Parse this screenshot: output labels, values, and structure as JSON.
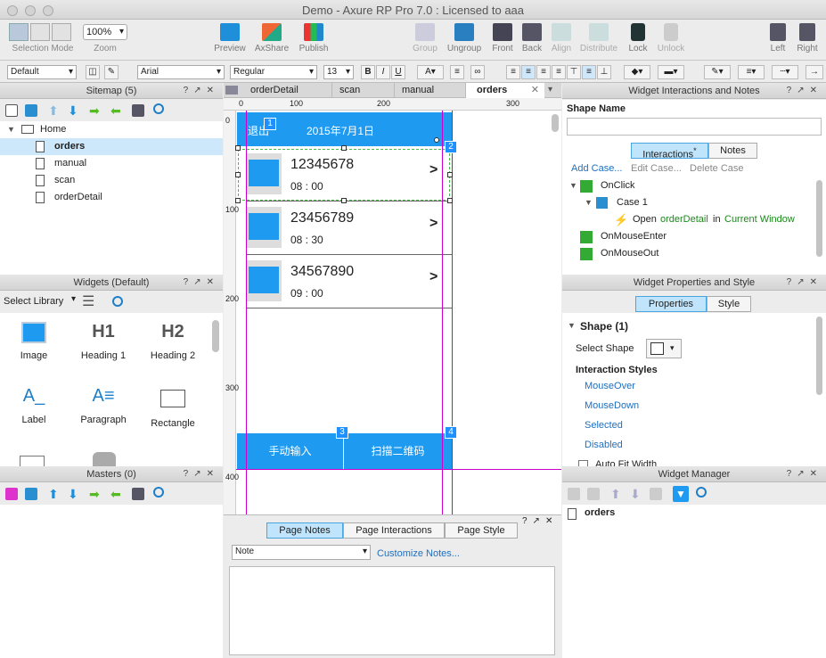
{
  "window": {
    "title": "Demo - Axure RP Pro 7.0 : Licensed to aaa"
  },
  "toolbar": {
    "selection_mode": "Selection Mode",
    "zoom_value": "100%",
    "zoom": "Zoom",
    "preview": "Preview",
    "axshare": "AxShare",
    "publish": "Publish",
    "group": "Group",
    "ungroup": "Ungroup",
    "front": "Front",
    "back": "Back",
    "align": "Align",
    "distribute": "Distribute",
    "lock": "Lock",
    "unlock": "Unlock",
    "left": "Left",
    "right": "Right"
  },
  "format": {
    "style": "Default",
    "font": "Arial",
    "weight": "Regular",
    "size": "13"
  },
  "sitemap": {
    "title": "Sitemap (5)",
    "root": "Home",
    "pages": [
      "orders",
      "manual",
      "scan",
      "orderDetail"
    ],
    "selected": "orders"
  },
  "widgets": {
    "title": "Widgets (Default)",
    "select_library": "Select Library",
    "items": [
      {
        "label": "Image",
        "glyph": ""
      },
      {
        "label": "Heading 1",
        "glyph": "H1"
      },
      {
        "label": "Heading 2",
        "glyph": "H2"
      },
      {
        "label": "Label",
        "glyph": "A_"
      },
      {
        "label": "Paragraph",
        "glyph": "A≡"
      },
      {
        "label": "Rectangle",
        "glyph": ""
      }
    ]
  },
  "masters": {
    "title": "Masters (0)"
  },
  "tabs": [
    {
      "label": "orderDetail"
    },
    {
      "label": "scan"
    },
    {
      "label": "manual"
    },
    {
      "label": "orders"
    }
  ],
  "ruler": {
    "top": [
      "0",
      "100",
      "200",
      "300"
    ],
    "left": [
      "0",
      "100",
      "200",
      "300",
      "400"
    ]
  },
  "mockup": {
    "header_left": "退出",
    "header_title": "2015年7月1日",
    "orders": [
      {
        "number": "12345678",
        "time": "08 : 00"
      },
      {
        "number": "23456789",
        "time": "08 : 30"
      },
      {
        "number": "34567890",
        "time": "09 : 00"
      }
    ],
    "arrow": ">",
    "btn_manual": "手动输入",
    "btn_scan": "扫描二维码",
    "markers": [
      "1",
      "2",
      "3",
      "4"
    ]
  },
  "page_notes": {
    "tabs": [
      "Page Notes",
      "Page Interactions",
      "Page Style"
    ],
    "note_select": "Note",
    "customize": "Customize Notes..."
  },
  "interactions_panel": {
    "title": "Widget Interactions and Notes",
    "shape_name_label": "Shape Name",
    "shape_name_value": "",
    "tabs": [
      "Interactions",
      "Notes"
    ],
    "tab_star": "*",
    "add_case": "Add Case...",
    "edit_case": "Edit Case...",
    "delete_case": "Delete Case",
    "events": [
      "OnClick",
      "OnMouseEnter",
      "OnMouseOut"
    ],
    "case": "Case 1",
    "action_open": "Open",
    "action_target": "orderDetail",
    "action_in": "in",
    "action_window": "Current Window"
  },
  "properties_panel": {
    "title": "Widget Properties and Style",
    "tabs": [
      "Properties",
      "Style"
    ],
    "section": "Shape (1)",
    "select_shape": "Select Shape",
    "interaction_styles": "Interaction Styles",
    "styles": [
      "MouseOver",
      "MouseDown",
      "Selected",
      "Disabled"
    ],
    "auto_fit": "Auto Fit Width"
  },
  "widget_manager": {
    "title": "Widget Manager",
    "page": "orders"
  },
  "colors": {
    "accent": "#1e9bf0",
    "selection": "#cde8fa"
  }
}
